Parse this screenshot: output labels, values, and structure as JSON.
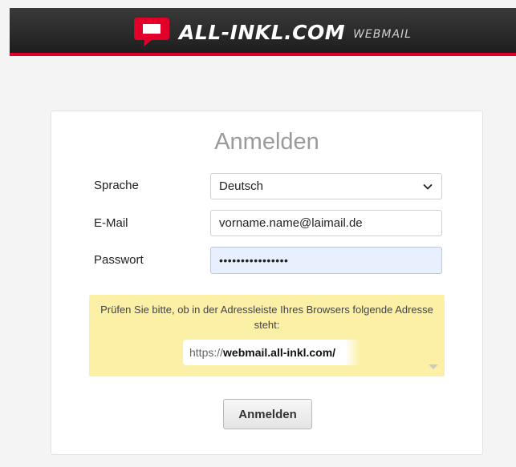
{
  "header": {
    "brand_name": "ALL-INKL.COM",
    "product_name": "WEBMAIL",
    "accent_color": "#e2002a",
    "logo_icon": "all-inkl-logo-icon"
  },
  "login": {
    "title": "Anmelden",
    "language": {
      "label": "Sprache",
      "selected_value": "Deutsch",
      "icon": "chevron-down-icon"
    },
    "email": {
      "label": "E-Mail",
      "value": "vorname.name@laimail.de"
    },
    "password": {
      "label": "Passwort",
      "masked_value": "••••••••••••••••"
    },
    "notice": {
      "text": "Prüfen Sie bitte, ob in der Adressleiste Ihres Browsers folgende Adresse steht:",
      "url_protocol": "https://",
      "url_host": "webmail.all-inkl.com/",
      "background_color": "#fbf0a6"
    },
    "submit_label": "Anmelden"
  }
}
